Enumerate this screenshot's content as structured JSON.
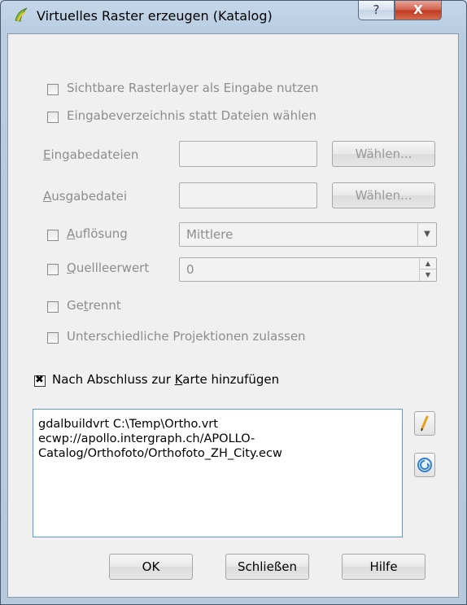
{
  "window": {
    "title": "Virtuelles Raster erzeugen (Katalog)",
    "help_glyph": "?",
    "close_glyph": "X"
  },
  "options": {
    "visible_layers": "Sichtbare Rasterlayer als Eingabe nutzen",
    "input_dir": "Eingabeverzeichnis statt Dateien wählen"
  },
  "input_files": {
    "label_first": "E",
    "label_rest": "ingabedateien",
    "button": "Wählen...",
    "value": ""
  },
  "output_file": {
    "label_first": "A",
    "label_rest": "usgabedatei",
    "button": "Wählen...",
    "value": ""
  },
  "resolution": {
    "label_first": "A",
    "label_rest": "uflösung",
    "value": "Mittlere"
  },
  "nodata": {
    "label_first": "Q",
    "label_rest": "uellleerwert",
    "value": "0"
  },
  "separate": {
    "label_pre": "Ge",
    "label_ul": "t",
    "label_post": "rennt"
  },
  "allow_proj": "Unterschiedliche Projektionen zulassen",
  "add_to_map": {
    "label_pre": "Nach Abschluss zur ",
    "label_ul": "K",
    "label_post": "arte hinzufügen",
    "checked": true
  },
  "command": "gdalbuildvrt C:\\Temp\\Ortho.vrt\necwp://apollo.intergraph.ch/APOLLO-\nCatalog/Orthofoto/Orthofoto_ZH_City.ecw",
  "buttons": {
    "ok": "OK",
    "close": "Schließen",
    "help": "Hilfe"
  },
  "icons": {
    "app": "qgis-icon",
    "edit": "pencil-icon",
    "refresh": "refresh-icon"
  }
}
